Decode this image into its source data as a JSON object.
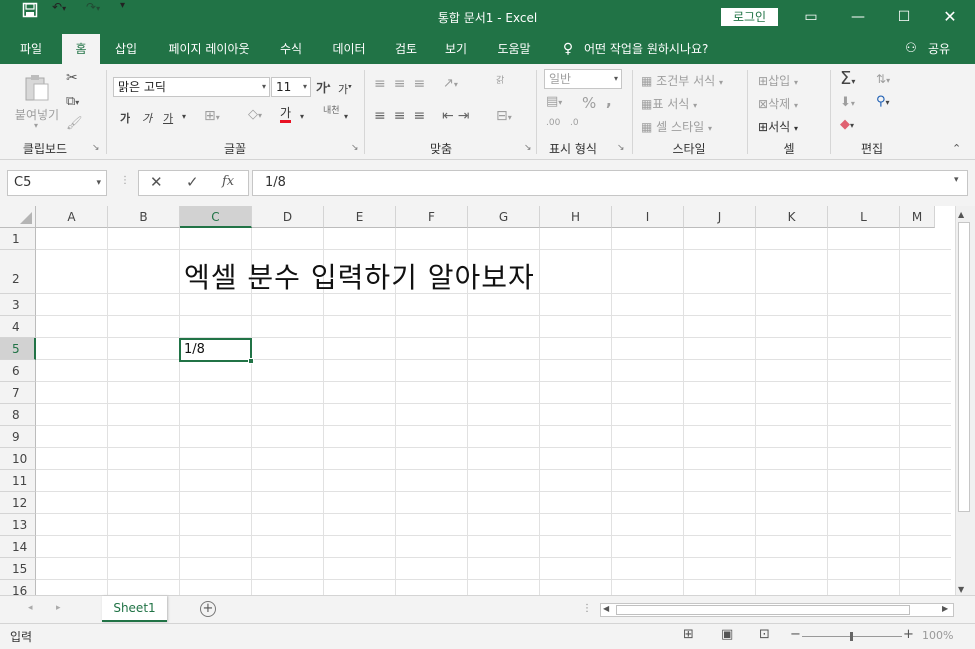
{
  "titlebar": {
    "title": "통합 문서1  -  Excel",
    "login": "로그인",
    "save_icon": "save-icon",
    "undo_icon": "undo-icon",
    "redo_icon": "redo-icon"
  },
  "menu": {
    "tabs": [
      "파일",
      "홈",
      "삽입",
      "페이지 레이아웃",
      "수식",
      "데이터",
      "검토",
      "보기",
      "도움말"
    ],
    "tellme": "어떤 작업을 원하시나요?",
    "share": "공유"
  },
  "ribbon": {
    "clipboard": {
      "paste": "붙여넣기",
      "label": "클립보드"
    },
    "font": {
      "name": "맑은 고딕",
      "size": "11",
      "grow": "가",
      "shrink": "가",
      "bold": "가",
      "italic": "가",
      "underline": "가",
      "color_letter": "가",
      "phonetic": "내천",
      "label": "글꼴"
    },
    "alignment": {
      "wrap": "갉",
      "label": "맞춤"
    },
    "number": {
      "format": "일반",
      "percent": "%",
      "comma": ",",
      "inc": ".00",
      "dec": ".0",
      "label": "표시 형식"
    },
    "styles": {
      "conditional": "조건부 서식",
      "table": "표 서식",
      "cell": "셀 스타일",
      "label": "스타일"
    },
    "cells": {
      "insert": "삽입",
      "delete": "삭제",
      "format": "서식",
      "label": "셀"
    },
    "editing": {
      "label": "편집"
    }
  },
  "formula_bar": {
    "name_box": "C5",
    "value": "1/8"
  },
  "columns": [
    "A",
    "B",
    "C",
    "D",
    "E",
    "F",
    "G",
    "H",
    "I",
    "J",
    "K",
    "L",
    "M"
  ],
  "rows": [
    "1",
    "2",
    "3",
    "4",
    "5",
    "6",
    "7",
    "8",
    "9",
    "10",
    "11",
    "12",
    "13",
    "14",
    "15",
    "16"
  ],
  "cells": {
    "title": "엑셀 분수 입력하기 알아보자",
    "c5": "1/8"
  },
  "sheets": {
    "active": "Sheet1"
  },
  "status": {
    "mode": "입력",
    "zoom": "100%"
  },
  "colors": {
    "accent": "#217346"
  }
}
